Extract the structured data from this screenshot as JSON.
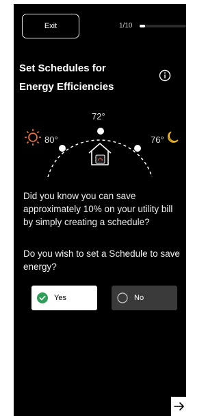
{
  "header": {
    "exit_label": "Exit",
    "step": "1/10",
    "progress_fraction": 0.1
  },
  "title": {
    "line1": "Set Schedules for",
    "line2": "Energy Efficiencies"
  },
  "diagram": {
    "temp_left": "80°",
    "temp_center": "72°",
    "temp_right": "76°"
  },
  "body": {
    "fact": "Did you know you can save approximately 10% on your utility bill by simply creating a schedule?",
    "question": "Do you wish to set a Schedule to save energy?"
  },
  "options": {
    "yes_label": "Yes",
    "no_label": "No",
    "selected": "Yes"
  },
  "colors": {
    "background": "#000000",
    "sun": "#ff7a3d",
    "moon": "#f2b91e",
    "check": "#2e9e58"
  },
  "icons": [
    "info-icon",
    "sun-icon",
    "moon-icon",
    "home-icon",
    "checkmark-icon",
    "arrow-right-icon"
  ]
}
